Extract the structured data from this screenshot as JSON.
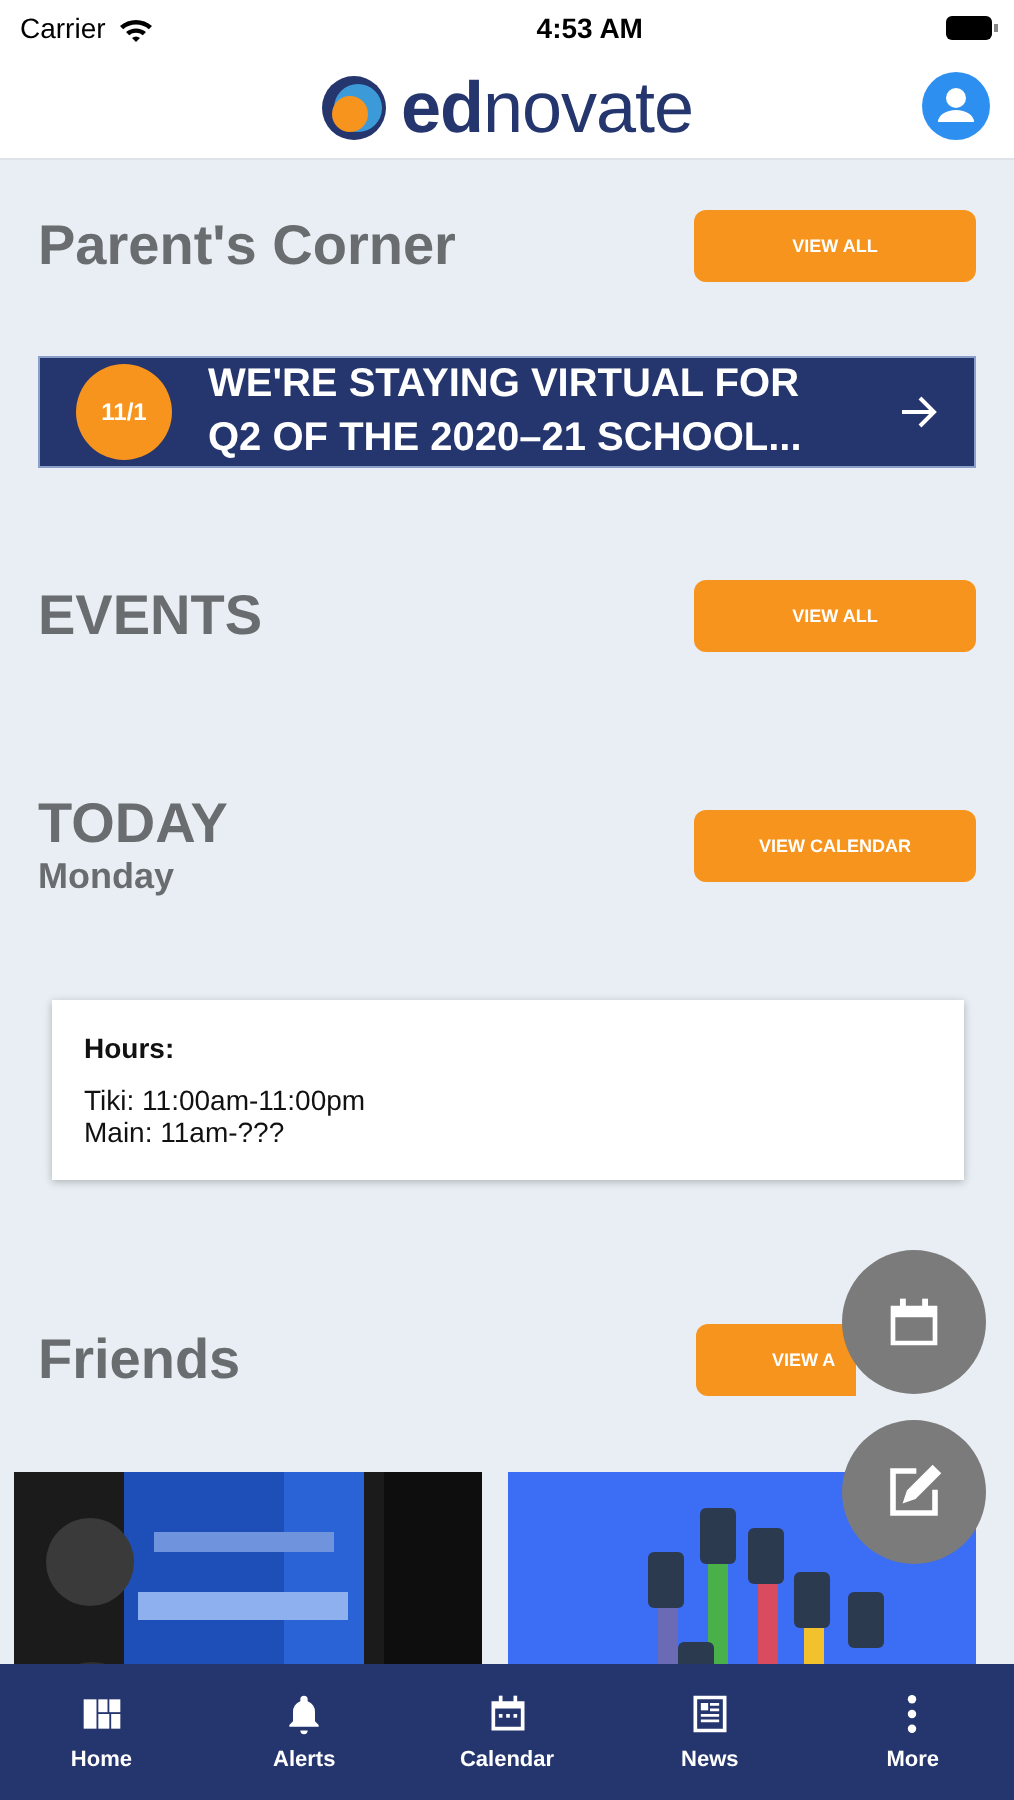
{
  "status_bar": {
    "carrier": "Carrier",
    "time": "4:53 AM"
  },
  "header": {
    "logo": "**ed**novate"
  },
  "parents_corner": {
    "title": "Parent's Corner",
    "button": "VIEW ALL",
    "banner": {
      "date": "11/1",
      "text": "WE'RE STAYING VIRTUAL FOR Q2 OF THE 2020–21 SCHOOL..."
    }
  },
  "events": {
    "title": "EVENTS",
    "button": "VIEW ALL"
  },
  "today": {
    "title": "TODAY",
    "day": "Monday",
    "button": "VIEW CALENDAR",
    "card": {
      "heading": "Hours:",
      "lines": [
        "Tiki: 11:00am-11:00pm",
        "Main: 11am-???"
      ]
    }
  },
  "friends": {
    "title": "Friends",
    "button": "VIEW A"
  },
  "fabs": [
    {
      "kind": "calendar"
    },
    {
      "kind": "edit"
    }
  ],
  "tab_bar": [
    {
      "label": "Home",
      "kind": "home"
    },
    {
      "label": "Alerts",
      "kind": "bell"
    },
    {
      "label": "Calendar",
      "kind": "calendar"
    },
    {
      "label": "News",
      "kind": "news"
    },
    {
      "label": "More",
      "kind": "more"
    }
  ]
}
